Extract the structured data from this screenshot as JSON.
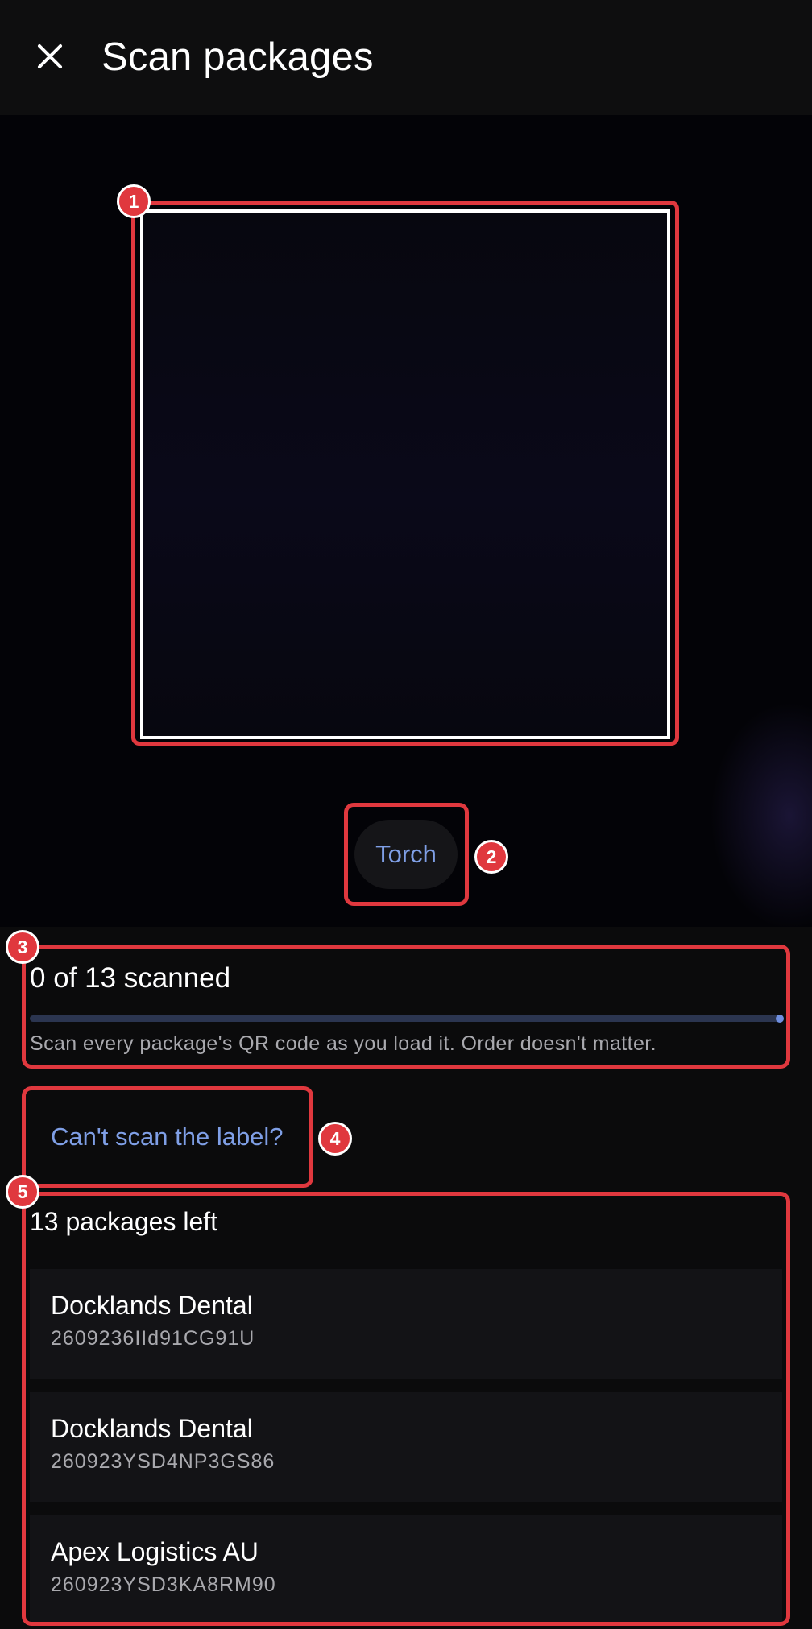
{
  "header": {
    "title": "Scan packages",
    "close_icon": "close-icon"
  },
  "scanner": {
    "torch_label": "Torch"
  },
  "progress": {
    "title": "0 of 13 scanned",
    "scanned": 0,
    "total": 13,
    "fraction": 0,
    "hint": "Scan every package's QR code as you load it. Order doesn't matter."
  },
  "help_link": "Can't scan the label?",
  "packages": {
    "heading": "13 packages left",
    "items": [
      {
        "name": "Docklands Dental",
        "code": "2609236IId91CG91U"
      },
      {
        "name": "Docklands Dental",
        "code": "260923YSD4NP3GS86"
      },
      {
        "name": "Apex Logistics AU",
        "code": "260923YSD3KA8RM90"
      }
    ]
  },
  "annotations": [
    "1",
    "2",
    "3",
    "4",
    "5"
  ],
  "colors": {
    "annotation_red": "#e0383e",
    "accent_blue": "#7f9fe6",
    "background": "#0b0b0c",
    "card": "#131316"
  }
}
